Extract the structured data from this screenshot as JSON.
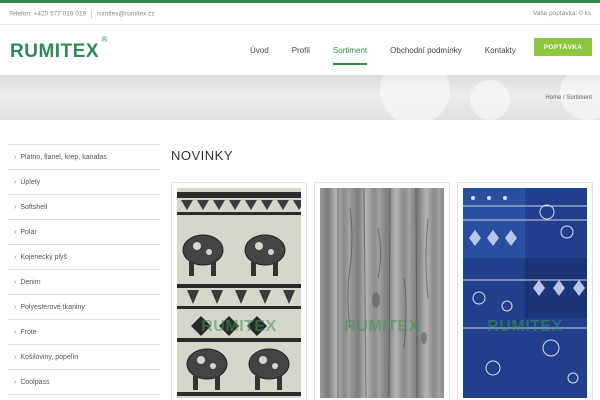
{
  "topbar": {
    "phone": "Telefon: +420 577 019 019",
    "email": "rumitex@rumitex.cz",
    "cart": "Vaše poptávka: 0 ks"
  },
  "logo": {
    "text": "RUMITEX",
    "mark": "®"
  },
  "nav": {
    "items": [
      {
        "label": "Úvod"
      },
      {
        "label": "Profil"
      },
      {
        "label": "Sortiment"
      },
      {
        "label": "Obchodní podmínky"
      },
      {
        "label": "Kontakty"
      }
    ],
    "active_index": 2,
    "cta_label": "POPTÁVKA"
  },
  "breadcrumb": "Home / Sortiment",
  "sidebar": {
    "items": [
      {
        "label": "Plátno, flanel, krep, kanafas"
      },
      {
        "label": "Úplety"
      },
      {
        "label": "Softshell"
      },
      {
        "label": "Polar"
      },
      {
        "label": "Kojenecký plyš"
      },
      {
        "label": "Denim"
      },
      {
        "label": "Polyesterové tkaniny"
      },
      {
        "label": "Frote"
      },
      {
        "label": "Košiloviny, popelín"
      },
      {
        "label": "Coolpass"
      }
    ]
  },
  "main": {
    "title": "NOVINKY",
    "watermark": "RUMITEX"
  },
  "colors": {
    "brand": "#2e8b57",
    "cta": "#8dc63f"
  },
  "icons": {
    "chevron": "chevron-right-icon"
  }
}
